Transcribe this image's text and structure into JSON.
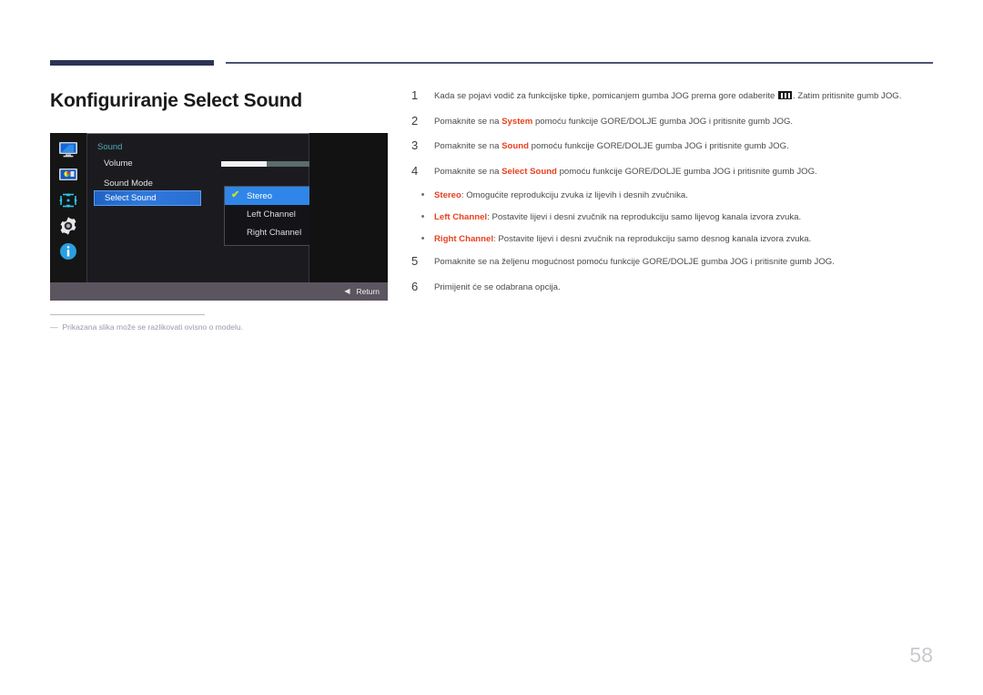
{
  "document": {
    "title": "Konfiguriranje Select Sound",
    "page_number": "58",
    "footnote": "Prikazana slika može se razlikovati ovisno o modelu.",
    "footnote_dash": "―"
  },
  "osd": {
    "section_title": "Sound",
    "rows": [
      {
        "label": "Volume",
        "value": "50"
      },
      {
        "label": "Sound Mode",
        "value": ""
      },
      {
        "label": "Select Sound",
        "value": ""
      }
    ],
    "volume_value": "50",
    "volume_percent": 50,
    "dropdown": [
      {
        "label": "Stereo",
        "selected": true,
        "check": "✔"
      },
      {
        "label": "Left Channel",
        "selected": false,
        "check": ""
      },
      {
        "label": "Right Channel",
        "selected": false,
        "check": ""
      }
    ],
    "footer": {
      "icon": "◀",
      "label": "Return"
    },
    "sidebar_icons": [
      "display-icon",
      "picture-icon",
      "onscreen-display-icon",
      "system-gear-icon",
      "information-icon"
    ],
    "colors": {
      "highlight_blue": "#2f86e8",
      "section_teal": "#4da9b5",
      "check_green": "#c9e02a",
      "panel_bg": "#1b1b1f",
      "footer_bg": "#5b5560"
    }
  },
  "steps": [
    {
      "num": "1",
      "pre": "Kada se pojavi vodič za funkcijske tipke, pomicanjem gumba JOG prema gore odaberite ",
      "glyph": "menu-glyph",
      "post": ". Zatim pritisnite gumb JOG."
    },
    {
      "num": "2",
      "pre": "Pomaknite se na ",
      "kw": "System",
      "post": " pomoću funkcije GORE/DOLJE gumba JOG i pritisnite gumb JOG."
    },
    {
      "num": "3",
      "pre": "Pomaknite se na ",
      "kw": "Sound",
      "post": " pomoću funkcije GORE/DOLJE gumba JOG i pritisnite gumb JOG."
    },
    {
      "num": "4",
      "pre": "Pomaknite se na ",
      "kw": "Select Sound",
      "post": " pomoću funkcije GORE/DOLJE gumba JOG i pritisnite gumb JOG."
    }
  ],
  "bullets": [
    {
      "dot": "•",
      "kw": "Stereo",
      "text": ": Omogućite reprodukciju zvuka iz lijevih i desnih zvučnika."
    },
    {
      "dot": "•",
      "kw": "Left Channel",
      "text": ": Postavite lijevi i desni zvučnik na reprodukciju samo lijevog kanala izvora zvuka."
    },
    {
      "dot": "•",
      "kw": "Right Channel",
      "text": ": Postavite lijevi i desni zvučnik na reprodukciju samo desnog kanala izvora zvuka."
    }
  ],
  "steps_tail": [
    {
      "num": "5",
      "pre": "Pomaknite se na željenu mogućnost pomoću funkcije GORE/DOLJE gumba JOG i pritisnite gumb JOG.",
      "kw": "",
      "post": ""
    },
    {
      "num": "6",
      "pre": "Primijenit će se odabrana opcija.",
      "kw": "",
      "post": ""
    }
  ]
}
